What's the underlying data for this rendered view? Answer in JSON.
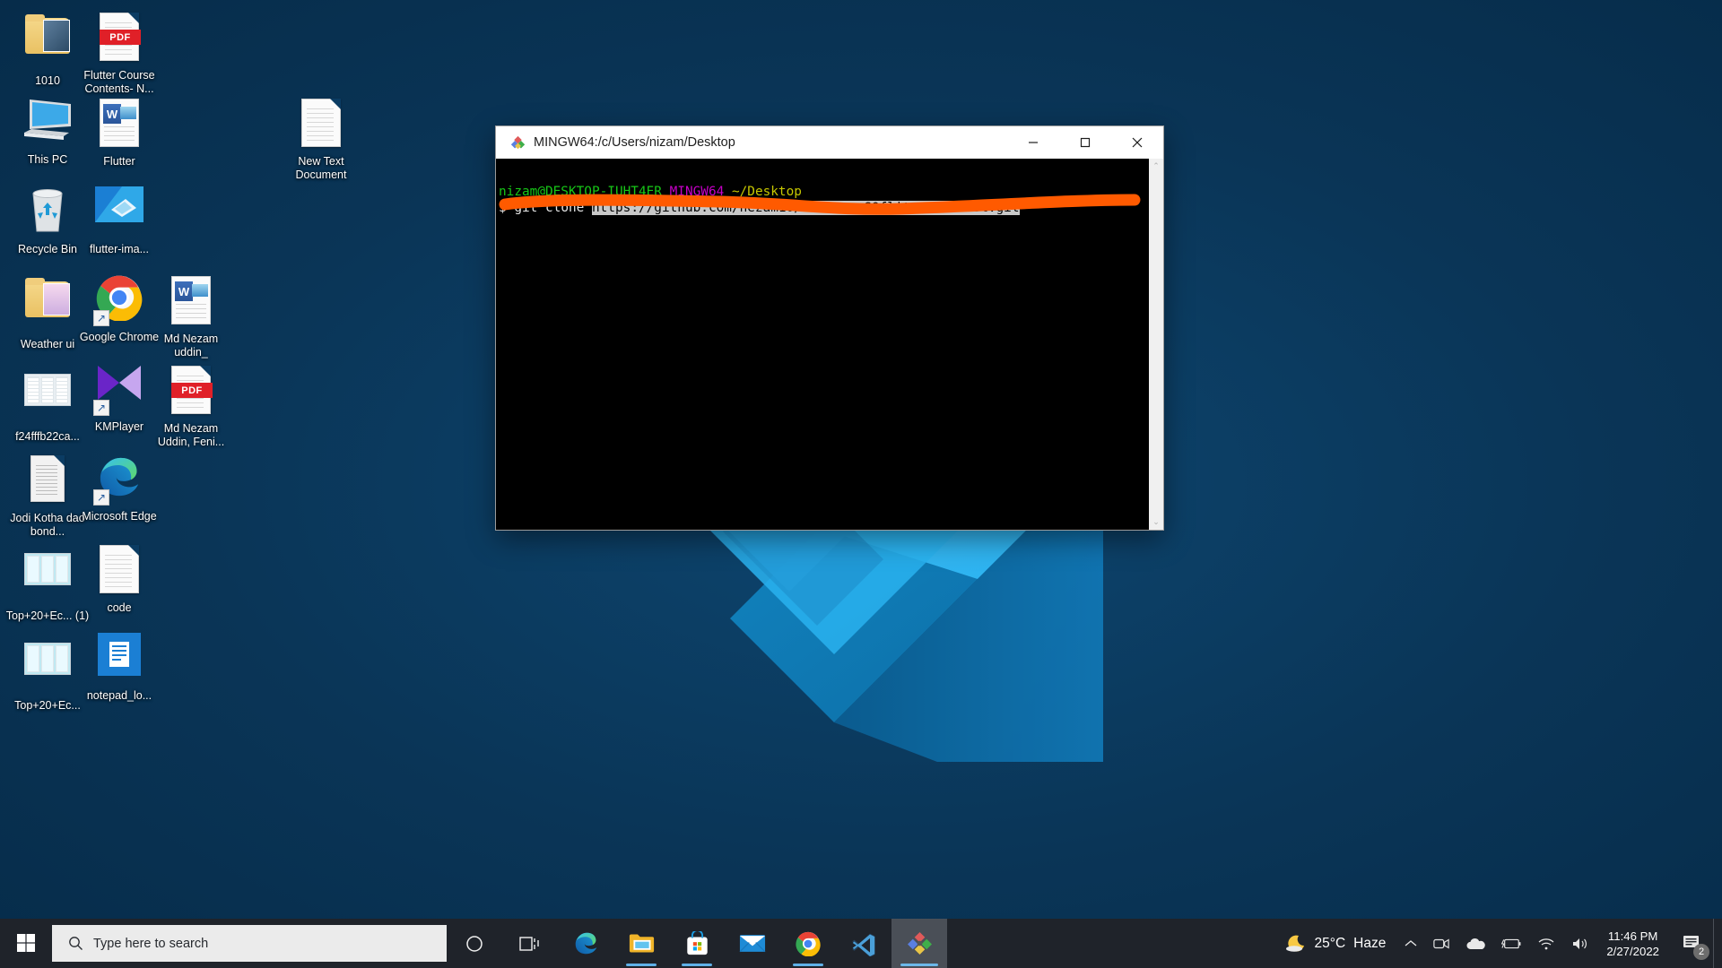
{
  "desktop": {
    "background_color": "#0b3c63",
    "wallpaper": "flutter-logo-wallpaper",
    "icons": [
      {
        "label": "1010",
        "art": "folder-photo",
        "shortcut": false,
        "col": 0,
        "row": 0
      },
      {
        "label": "Flutter Course Contents- N...",
        "art": "pdf",
        "shortcut": false,
        "col": 1,
        "row": 0
      },
      {
        "label": "This PC",
        "art": "this-pc",
        "shortcut": false,
        "col": 0,
        "row": 1
      },
      {
        "label": "Flutter",
        "art": "word-doc",
        "shortcut": false,
        "col": 1,
        "row": 1
      },
      {
        "label": "New Text Document",
        "art": "text-doc",
        "shortcut": false,
        "col": 3,
        "row": 1
      },
      {
        "label": "Recycle Bin",
        "art": "recycle-bin",
        "shortcut": false,
        "col": 0,
        "row": 2
      },
      {
        "label": "flutter-ima...",
        "art": "image-blue",
        "shortcut": false,
        "col": 1,
        "row": 2
      },
      {
        "label": "Weather ui",
        "art": "folder-ui",
        "shortcut": false,
        "col": 0,
        "row": 3
      },
      {
        "label": "Google Chrome",
        "art": "chrome",
        "shortcut": true,
        "col": 1,
        "row": 3
      },
      {
        "label": "Md Nezam uddin_",
        "art": "word-doc",
        "shortcut": false,
        "col": 2,
        "row": 3
      },
      {
        "label": "f24fffb22ca...",
        "art": "ui-mock",
        "shortcut": false,
        "col": 0,
        "row": 4
      },
      {
        "label": "KMPlayer",
        "art": "kmplayer",
        "shortcut": true,
        "col": 1,
        "row": 4
      },
      {
        "label": "Md Nezam Uddin, Feni...",
        "art": "pdf",
        "shortcut": false,
        "col": 2,
        "row": 4
      },
      {
        "label": "Jodi Kotha dao bond...",
        "art": "text-page",
        "shortcut": false,
        "col": 0,
        "row": 5
      },
      {
        "label": "Microsoft Edge",
        "art": "edge",
        "shortcut": true,
        "col": 1,
        "row": 5
      },
      {
        "label": "Top+20+Ec... (1)",
        "art": "ui-mock-blue",
        "shortcut": false,
        "col": 0,
        "row": 6
      },
      {
        "label": "code",
        "art": "text-doc",
        "shortcut": false,
        "col": 1,
        "row": 6
      },
      {
        "label": "Top+20+Ec...",
        "art": "ui-mock-blue",
        "shortcut": false,
        "col": 0,
        "row": 7
      },
      {
        "label": "notepad_lo...",
        "art": "notepad-blue",
        "shortcut": false,
        "col": 1,
        "row": 7
      }
    ]
  },
  "window": {
    "title": "MINGW64:/c/Users/nizam/Desktop",
    "icon": "git-bash-icon",
    "minimize_label": "—",
    "maximize_label": "□",
    "close_label": "✕",
    "terminal": {
      "prompt_user_host": "nizam@DESKTOP-IUHT4ER",
      "prompt_shell": "MINGW64",
      "prompt_path": "~/Desktop",
      "dollar": "$",
      "command": "git clone",
      "selected_argument": "https://github.com/nezam10/Flutter-SQflite-todolist.git",
      "colors": {
        "user_host": "#17c717",
        "shell": "#c800c8",
        "path": "#c7c700",
        "text": "#e8e8e8",
        "selection_bg": "#c8c8c8",
        "background": "#000000"
      }
    },
    "annotation": {
      "type": "marker-underline",
      "color": "#ff5a00"
    },
    "scrollbar": {
      "up_arrow": "⌃",
      "down_arrow": "⌄"
    }
  },
  "taskbar": {
    "start_label": "start-button",
    "search": {
      "placeholder": "Type here to search",
      "icon": "search-icon"
    },
    "items": [
      {
        "name": "cortana",
        "icon": "circle-icon",
        "active": false,
        "running": false
      },
      {
        "name": "task-view",
        "icon": "task-view-icon",
        "active": false,
        "running": false
      },
      {
        "name": "microsoft-edge",
        "icon": "edge-icon",
        "active": false,
        "running": false
      },
      {
        "name": "file-explorer",
        "icon": "folder-icon",
        "active": false,
        "running": true
      },
      {
        "name": "microsoft-store",
        "icon": "store-icon",
        "active": false,
        "running": true
      },
      {
        "name": "mail",
        "icon": "mail-icon",
        "active": false,
        "running": false
      },
      {
        "name": "google-chrome",
        "icon": "chrome-icon",
        "active": false,
        "running": true
      },
      {
        "name": "visual-studio-code",
        "icon": "vscode-icon",
        "active": false,
        "running": false
      },
      {
        "name": "git-bash",
        "icon": "git-bash-icon",
        "active": true,
        "running": true
      }
    ],
    "tray": {
      "weather": {
        "icon": "moon-icon",
        "temperature": "25°C",
        "condition": "Haze"
      },
      "show_hidden_icons": "⌃",
      "icons": [
        {
          "name": "meet-now-icon",
          "glyph": "⬜"
        },
        {
          "name": "onedrive-icon",
          "glyph": "☁"
        },
        {
          "name": "battery-charging-icon",
          "glyph": "▭"
        },
        {
          "name": "wifi-icon",
          "glyph": "◠"
        },
        {
          "name": "volume-icon",
          "glyph": "🔊"
        }
      ],
      "clock": {
        "time": "11:46 PM",
        "date": "2/27/2022"
      },
      "notifications": {
        "icon": "action-center-icon",
        "count": "2"
      }
    }
  }
}
